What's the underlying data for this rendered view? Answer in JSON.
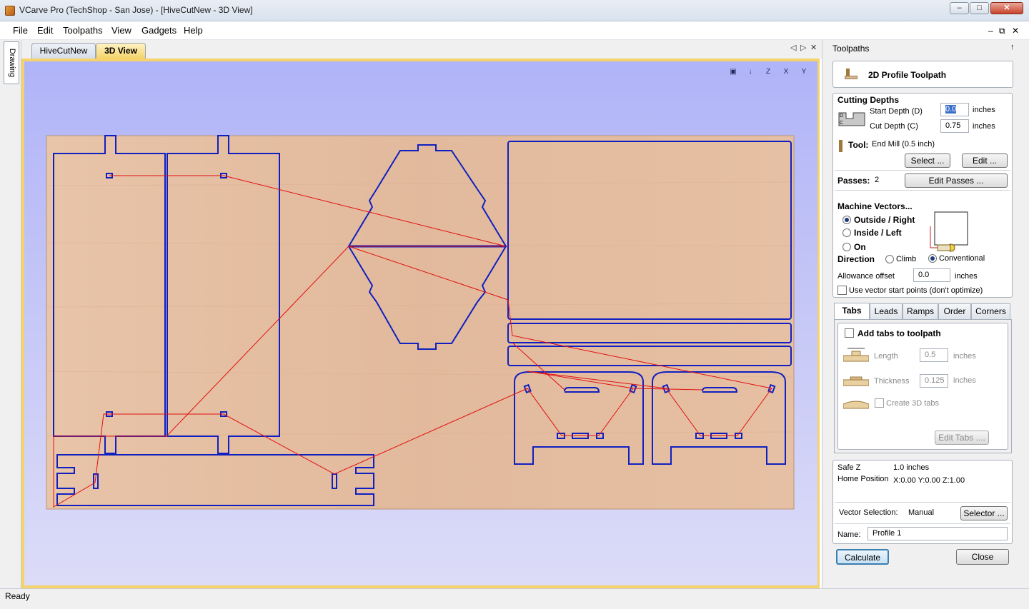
{
  "window": {
    "title": "VCarve Pro (TechShop - San Jose) - [HiveCutNew - 3D View]",
    "min": "–",
    "max": "□",
    "close": "✕"
  },
  "menu": [
    "File",
    "Edit",
    "Toolpaths",
    "View",
    "Gadgets",
    "Help"
  ],
  "mdi_controls": [
    "–",
    "⧉",
    "✕"
  ],
  "side_tab": "Drawing",
  "doc_tabs": [
    "HiveCutNew",
    "3D View"
  ],
  "tab_nav": [
    "◁",
    "▷",
    "✕"
  ],
  "view_icons": [
    "▣",
    "↓",
    "Z",
    "X",
    "Y"
  ],
  "status": "Ready",
  "panel": {
    "title": "Toolpaths",
    "pin": "↑",
    "toolpath_name": "2D Profile Toolpath",
    "cutting_depths": {
      "heading": "Cutting Depths",
      "start_label": "Start Depth (D)",
      "start_value": "0.0",
      "cut_label": "Cut Depth (C)",
      "cut_value": "0.75",
      "unit": "inches"
    },
    "tool": {
      "label": "Tool:",
      "value": "End Mill (0.5 inch)",
      "select": "Select ...",
      "edit": "Edit ..."
    },
    "passes": {
      "label": "Passes:",
      "value": "2",
      "button": "Edit Passes ..."
    },
    "machine": {
      "heading": "Machine Vectors...",
      "options": [
        "Outside / Right",
        "Inside / Left",
        "On"
      ],
      "selected": "Outside / Right",
      "direction_label": "Direction",
      "directions": [
        "Climb",
        "Conventional"
      ],
      "direction_selected": "Conventional",
      "allowance_label": "Allowance offset",
      "allowance_value": "0.0",
      "allowance_unit": "inches",
      "use_start_points": "Use vector start points (don't optimize)"
    },
    "tabs": [
      "Tabs",
      "Leads",
      "Ramps",
      "Order",
      "Corners"
    ],
    "active_tab": "Tabs",
    "tabs_panel": {
      "add_label": "Add tabs to toolpath",
      "length_label": "Length",
      "length_value": "0.5",
      "thickness_label": "Thickness",
      "thickness_value": "0.125",
      "unit": "inches",
      "create_3d": "Create 3D tabs",
      "edit_tabs": "Edit Tabs ...."
    },
    "safe_z_label": "Safe Z",
    "safe_z_value": "1.0 inches",
    "home_label": "Home Position",
    "home_value": "X:0.00 Y:0.00 Z:1.00",
    "vector_sel_label": "Vector Selection:",
    "vector_sel_value": "Manual",
    "selector_button": "Selector ...",
    "name_label": "Name:",
    "name_value": "Profile 1",
    "calculate": "Calculate",
    "close": "Close"
  },
  "colors": {
    "accent_tab": "#f5d36a",
    "vector": "#1020c0",
    "toolpath_move": "#e01010",
    "material": "#e6c0a4"
  }
}
